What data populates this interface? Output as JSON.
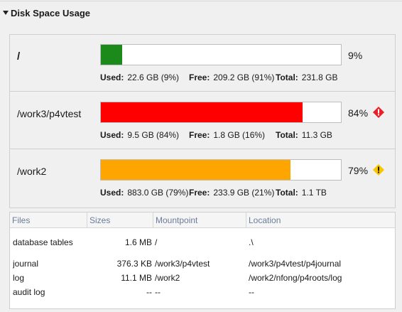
{
  "section": {
    "title": "Disk Space Usage",
    "expanded": true
  },
  "volumes": [
    {
      "name": "/",
      "percent_label": "9%",
      "percent": 9,
      "color": "#1b8a1b",
      "status": "ok",
      "used_label": "Used:",
      "used": "22.6 GB (9%)",
      "free_label": "Free:",
      "free": "209.2 GB (91%)",
      "total_label": "Total:",
      "total": "231.8 GB"
    },
    {
      "name": "/work3/p4vtest",
      "percent_label": "84%",
      "percent": 84,
      "color": "#ff0000",
      "status": "error",
      "status_icon": "error-diamond-icon",
      "used_label": "Used:",
      "used": "9.5 GB (84%)",
      "free_label": "Free:",
      "free": "1.8 GB (16%)",
      "total_label": "Total:",
      "total": "11.3 GB"
    },
    {
      "name": "/work2",
      "percent_label": "79%",
      "percent": 79,
      "color": "#ffa500",
      "status": "warning",
      "status_icon": "warning-diamond-icon",
      "used_label": "Used:",
      "used": "883.0 GB (79%)",
      "free_label": "Free:",
      "free": "233.9 GB (21%)",
      "total_label": "Total:",
      "total": "1.1 TB"
    }
  ],
  "table": {
    "columns": [
      "Files",
      "Sizes",
      "Mountpoint",
      "Location"
    ],
    "rows": [
      {
        "file": "database tables",
        "size": "1.6 MB",
        "mount": "/",
        "location": ".\\"
      },
      {
        "file": "journal",
        "size": "376.3 KB",
        "mount": "/work3/p4vtest",
        "location": "/work3/p4vtest/p4journal"
      },
      {
        "file": "log",
        "size": "11.1 MB",
        "mount": "/work2",
        "location": "/work2/nfong/p4roots/log"
      },
      {
        "file": "audit log",
        "size": "--",
        "mount": "--",
        "location": "--"
      }
    ]
  }
}
